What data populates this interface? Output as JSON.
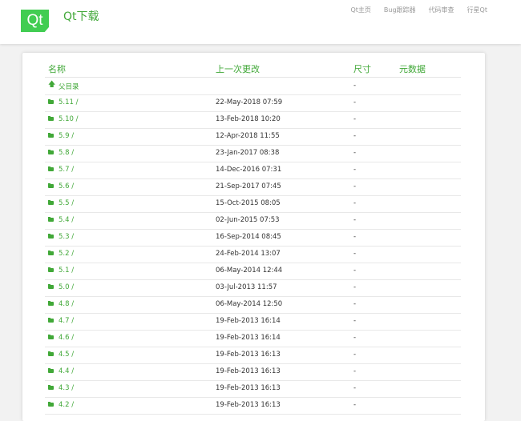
{
  "header": {
    "logo_text": "Qt",
    "site_title": "Qt下载",
    "nav": [
      "Qt主页",
      "Bug跟踪器",
      "代码审查",
      "行星Qt"
    ]
  },
  "table": {
    "columns": [
      "名称",
      "上一次更改",
      "尺寸",
      "元数据"
    ],
    "parent": {
      "label": "父目录",
      "size": "-",
      "icon": "up-arrow-icon"
    },
    "rows": [
      {
        "name": "5.11 /",
        "date": "22-May-2018 07:59",
        "size": "-"
      },
      {
        "name": "5.10 /",
        "date": "13-Feb-2018 10:20",
        "size": "-"
      },
      {
        "name": "5.9 /",
        "date": "12-Apr-2018 11:55",
        "size": "-"
      },
      {
        "name": "5.8 /",
        "date": "23-Jan-2017 08:38",
        "size": "-"
      },
      {
        "name": "5.7 /",
        "date": "14-Dec-2016 07:31",
        "size": "-"
      },
      {
        "name": "5.6 /",
        "date": "21-Sep-2017 07:45",
        "size": "-"
      },
      {
        "name": "5.5 /",
        "date": "15-Oct-2015 08:05",
        "size": "-"
      },
      {
        "name": "5.4 /",
        "date": "02-Jun-2015 07:53",
        "size": "-"
      },
      {
        "name": "5.3 /",
        "date": "16-Sep-2014 08:45",
        "size": "-"
      },
      {
        "name": "5.2 /",
        "date": "24-Feb-2014 13:07",
        "size": "-"
      },
      {
        "name": "5.1 /",
        "date": "06-May-2014 12:44",
        "size": "-"
      },
      {
        "name": "5.0 /",
        "date": "03-Jul-2013 11:57",
        "size": "-"
      },
      {
        "name": "4.8 /",
        "date": "06-May-2014 12:50",
        "size": "-"
      },
      {
        "name": "4.7 /",
        "date": "19-Feb-2013 16:14",
        "size": "-"
      },
      {
        "name": "4.6 /",
        "date": "19-Feb-2013 16:14",
        "size": "-"
      },
      {
        "name": "4.5 /",
        "date": "19-Feb-2013 16:13",
        "size": "-"
      },
      {
        "name": "4.4 /",
        "date": "19-Feb-2013 16:13",
        "size": "-"
      },
      {
        "name": "4.3 /",
        "date": "19-Feb-2013 16:13",
        "size": "-"
      },
      {
        "name": "4.2 /",
        "date": "19-Feb-2013 16:13",
        "size": "-"
      }
    ]
  },
  "colors": {
    "brand": "#41cd52",
    "link": "#41a838"
  }
}
